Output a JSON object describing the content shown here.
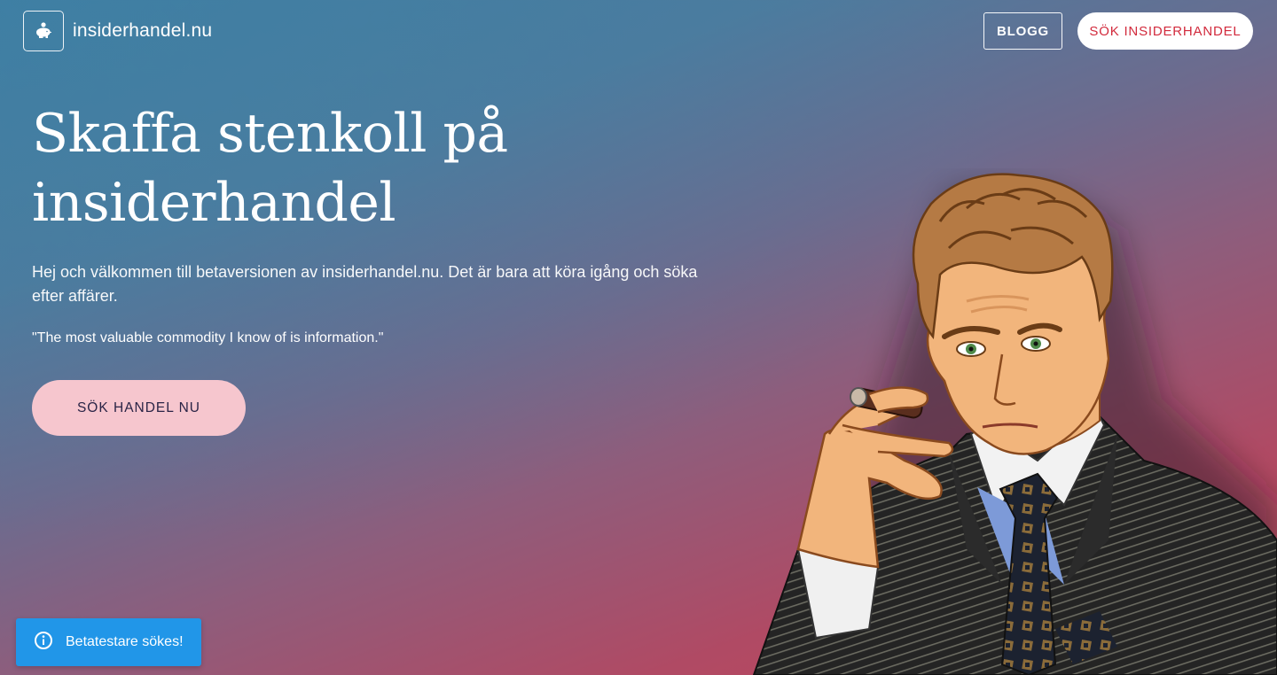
{
  "header": {
    "logo_text": "insiderhandel.nu",
    "logo_icon": "piggy-bank-icon",
    "nav": {
      "blogg_label": "BLOGG",
      "search_label": "SÖK INSIDERHANDEL"
    }
  },
  "hero": {
    "title_line1": "Skaffa stenkoll på",
    "title_line2": "insiderhandel",
    "intro": "Hej och välkommen till betaversionen av insiderhandel.nu. Det är bara att köra igång och söka efter affärer.",
    "quote": "\"The most valuable commodity I know of is information.\"",
    "cta_label": "SÖK HANDEL NU"
  },
  "toast": {
    "icon": "info-icon",
    "text": "Betatestare sökes!"
  },
  "colors": {
    "accent_red": "#d22a3c",
    "cta_pink": "#f6c6ce",
    "toast_blue": "#2196e8"
  }
}
